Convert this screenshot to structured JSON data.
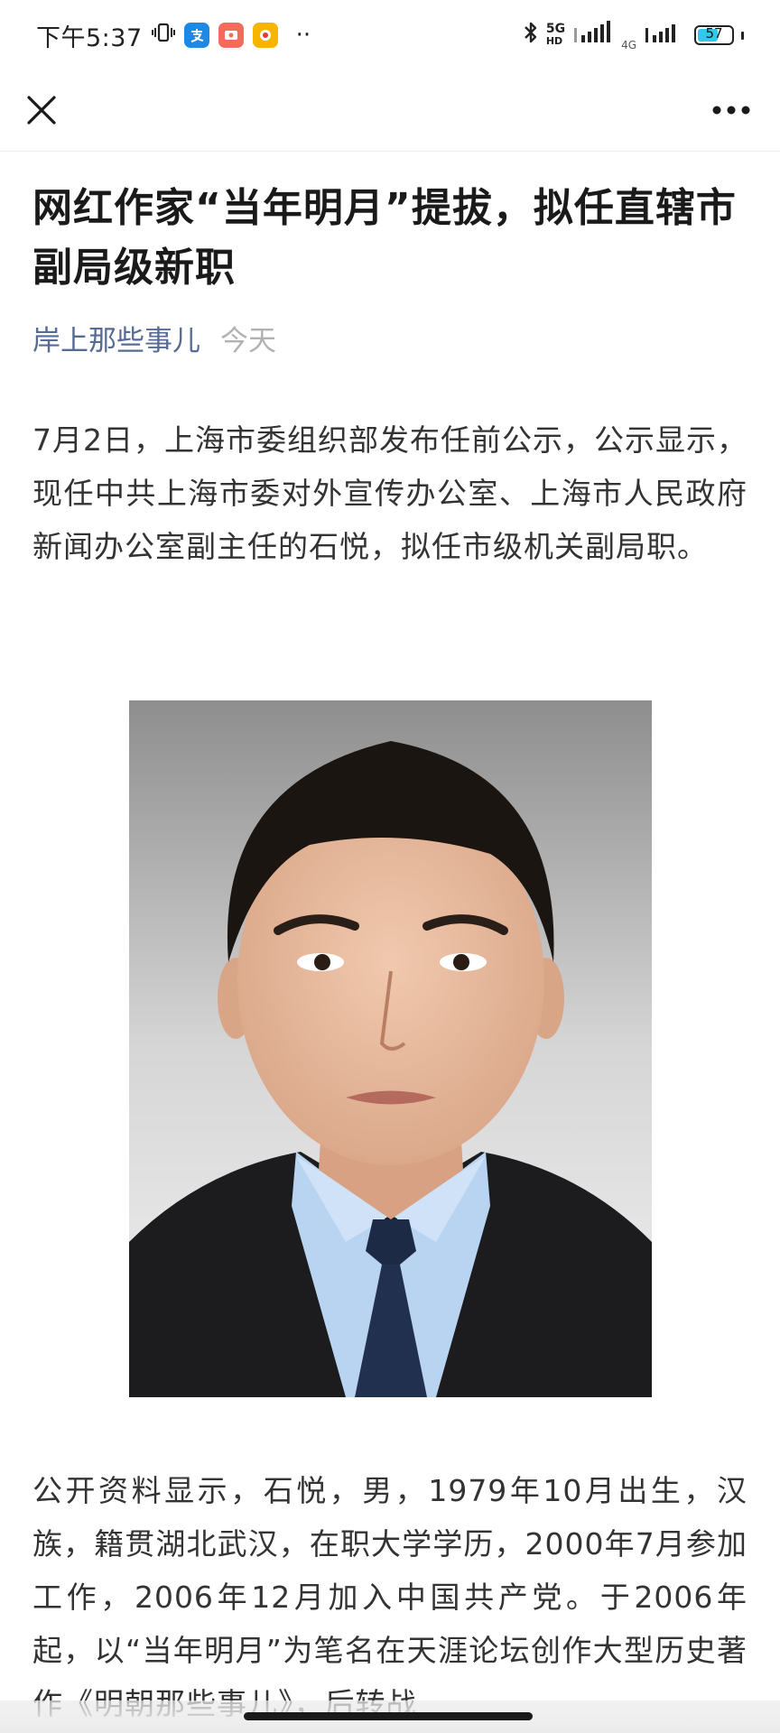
{
  "status_bar": {
    "time": "下午5:37",
    "network_5g": "5G",
    "network_4g": "4G",
    "battery": "57",
    "battery_level": 0.57,
    "overflow": "··"
  },
  "nav": {
    "close_icon": "close-icon",
    "more_icon": "more-icon"
  },
  "article": {
    "title": "网红作家“当年明月”提拔，拟任直辖市副局级新职",
    "source": "岸上那些事儿",
    "date": "今天",
    "paragraph_1": "7月2日，上海市委组织部发布任前公示，公示显示，现任中共上海市委对外宣传办公室、上海市人民政府新闻办公室副主任的石悦，拟任市级机关副局职。",
    "paragraph_2": "公开资料显示，石悦，男，1979年10月出生，汉族，籍贯湖北武汉，在职大学学历，2000年7月参加工作，2006年12月加入中国共产党。于2006年起，以“当年明月”为笔名在天涯论坛创作大型历史著作《明朝那些事儿》，后转战"
  },
  "colors": {
    "link": "#576b95",
    "muted": "#b2b2b2",
    "text": "#333333"
  }
}
